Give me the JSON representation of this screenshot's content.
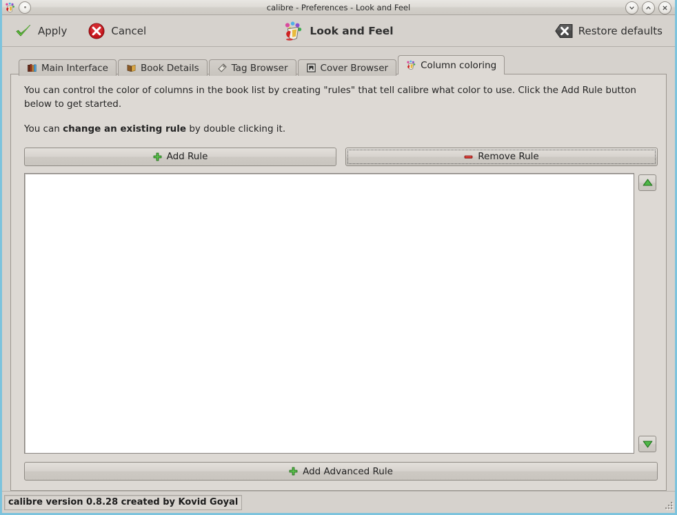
{
  "window": {
    "title": "calibre - Preferences - Look and Feel",
    "app_icon": "calibre-paint-pot-icon",
    "menu_button": "window-menu-icon",
    "controls": [
      {
        "name": "minimize-button",
        "glyph": "chevron-down-icon"
      },
      {
        "name": "maximize-button",
        "glyph": "chevron-up-icon"
      },
      {
        "name": "close-button",
        "glyph": "close-x-icon"
      }
    ]
  },
  "toolbar": {
    "apply_label": "Apply",
    "apply_icon": "green-check-icon",
    "cancel_label": "Cancel",
    "cancel_icon": "red-circle-x-icon",
    "title_label": "Look and Feel",
    "title_icon": "look-and-feel-paint-pot-icon",
    "restore_label": "Restore defaults",
    "restore_icon": "dark-badge-x-icon"
  },
  "tabs": [
    {
      "label": "Main Interface",
      "icon": "books-icon",
      "selected": false
    },
    {
      "label": "Book Details",
      "icon": "open-book-icon",
      "selected": false
    },
    {
      "label": "Tag Browser",
      "icon": "tag-icon",
      "selected": false
    },
    {
      "label": "Cover Browser",
      "icon": "picture-frame-icon",
      "selected": false
    },
    {
      "label": "Column coloring",
      "icon": "color-palette-icon",
      "selected": true
    }
  ],
  "panel": {
    "description_1": "You can control the color of columns in the book list by creating \"rules\" that tell calibre what color to use. Click the Add Rule button below to get started.",
    "description_2_prefix": "You can ",
    "description_2_bold": "change an existing rule",
    "description_2_suffix": " by double clicking it.",
    "add_rule_label": "Add Rule",
    "add_rule_icon": "green-plus-icon",
    "remove_rule_label": "Remove Rule",
    "remove_rule_icon": "red-minus-icon",
    "remove_rule_focused": true,
    "move_up_icon": "green-triangle-up-icon",
    "move_down_icon": "green-triangle-down-icon",
    "rules_list_items": [],
    "add_advanced_rule_label": "Add Advanced Rule",
    "add_advanced_rule_icon": "green-plus-icon"
  },
  "statusbar": {
    "text": "calibre version 0.8.28 created by Kovid Goyal",
    "resize_grip": "resize-grip-icon"
  },
  "colors": {
    "window_frame": "#7cc3dd",
    "chrome": "#d6d2cd",
    "panel": "#ddd9d4",
    "list_background": "#ffffff",
    "accent_green": "#3aa83a",
    "accent_red": "#c62020"
  }
}
